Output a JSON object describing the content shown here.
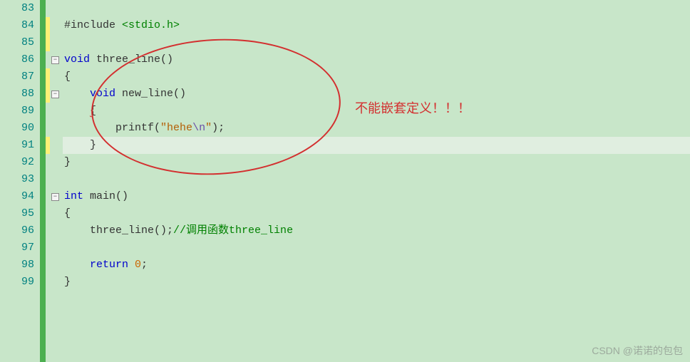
{
  "line_numbers": [
    "83",
    "84",
    "85",
    "86",
    "87",
    "88",
    "89",
    "90",
    "91",
    "92",
    "93",
    "94",
    "95",
    "96",
    "97",
    "98",
    "99"
  ],
  "change_marks": [
    false,
    true,
    true,
    false,
    true,
    true,
    false,
    false,
    true,
    false,
    false,
    false,
    false,
    false,
    false,
    false,
    false
  ],
  "highlight_line": 8,
  "fold_buttons": [
    {
      "line": 3,
      "symbol": "−"
    },
    {
      "line": 5,
      "symbol": "−"
    },
    {
      "line": 11,
      "symbol": "−"
    }
  ],
  "code": {
    "l0": "",
    "l1_pre": "#include ",
    "l1_inc": "<stdio.h>",
    "l2": "",
    "l3_kw": "void",
    "l3_name": " three_line()",
    "l4": "{",
    "l5_kw": "void",
    "l5_name": " new_line()",
    "l6": "{",
    "l7_fn": "printf",
    "l7_p1": "(",
    "l7_str1": "\"hehe",
    "l7_esc": "\\n",
    "l7_str2": "\"",
    "l7_p2": ");",
    "l8": "}",
    "l9": "}",
    "l10": "",
    "l11_kw": "int",
    "l11_name": " main()",
    "l12": "{",
    "l13_call": "three_line();",
    "l13_comment": "//调用函数three_line",
    "l14": "",
    "l15_kw": "return",
    "l15_num": " 0",
    "l15_p": ";",
    "l16": "}"
  },
  "annotation_text": "不能嵌套定义！！！",
  "watermark_text": "CSDN @诺诺的包包"
}
